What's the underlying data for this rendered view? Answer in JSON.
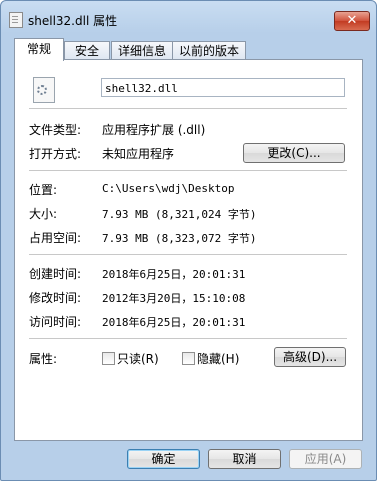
{
  "window": {
    "title": "shell32.dll 属性"
  },
  "tabs": [
    "常规",
    "安全",
    "详细信息",
    "以前的版本"
  ],
  "general": {
    "file_name": "shell32.dll",
    "file_type_label": "文件类型:",
    "file_type_value": "应用程序扩展 (.dll)",
    "opens_with_label": "打开方式:",
    "opens_with_value": "未知应用程序",
    "change_button": "更改(C)...",
    "location_label": "位置:",
    "location_value": "C:\\Users\\wdj\\Desktop",
    "size_label": "大小:",
    "size_value": "7.93 MB (8,321,024 字节)",
    "size_on_disk_label": "占用空间:",
    "size_on_disk_value": "7.93 MB (8,323,072 字节)",
    "created_label": "创建时间:",
    "created_value": "2018年6月25日，20:01:31",
    "modified_label": "修改时间:",
    "modified_value": "2012年3月20日，15:10:08",
    "accessed_label": "访问时间:",
    "accessed_value": "2018年6月25日，20:01:31",
    "attributes_label": "属性:",
    "readonly_label": "只读(R)",
    "hidden_label": "隐藏(H)",
    "advanced_button": "高级(D)..."
  },
  "buttons": {
    "ok": "确定",
    "cancel": "取消",
    "apply": "应用(A)"
  }
}
